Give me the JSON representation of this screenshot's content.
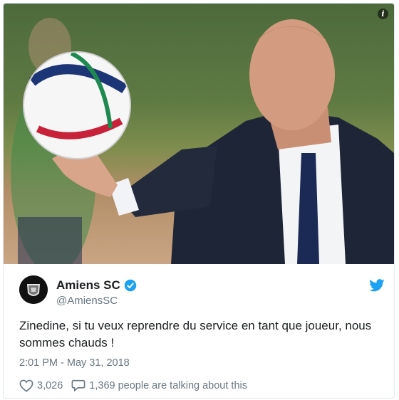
{
  "tweet": {
    "display_name": "Amiens SC",
    "handle": "@AmiensSC",
    "text": "Zinedine, si tu veux reprendre du service en tant que joueur, nous sommes chauds !",
    "timestamp": "2:01 PM - May 31, 2018",
    "likes": "3,026",
    "talking": "1,369 people are talking about this"
  },
  "icons": {
    "info": "info-icon",
    "verified": "verified-badge-icon",
    "platform": "twitter-bird-icon",
    "like": "heart-icon",
    "reply": "speech-bubble-icon"
  },
  "colors": {
    "verified": "#1da1f2",
    "text": "#1c2022",
    "muted": "#697882",
    "border": "#e1e8ed"
  }
}
